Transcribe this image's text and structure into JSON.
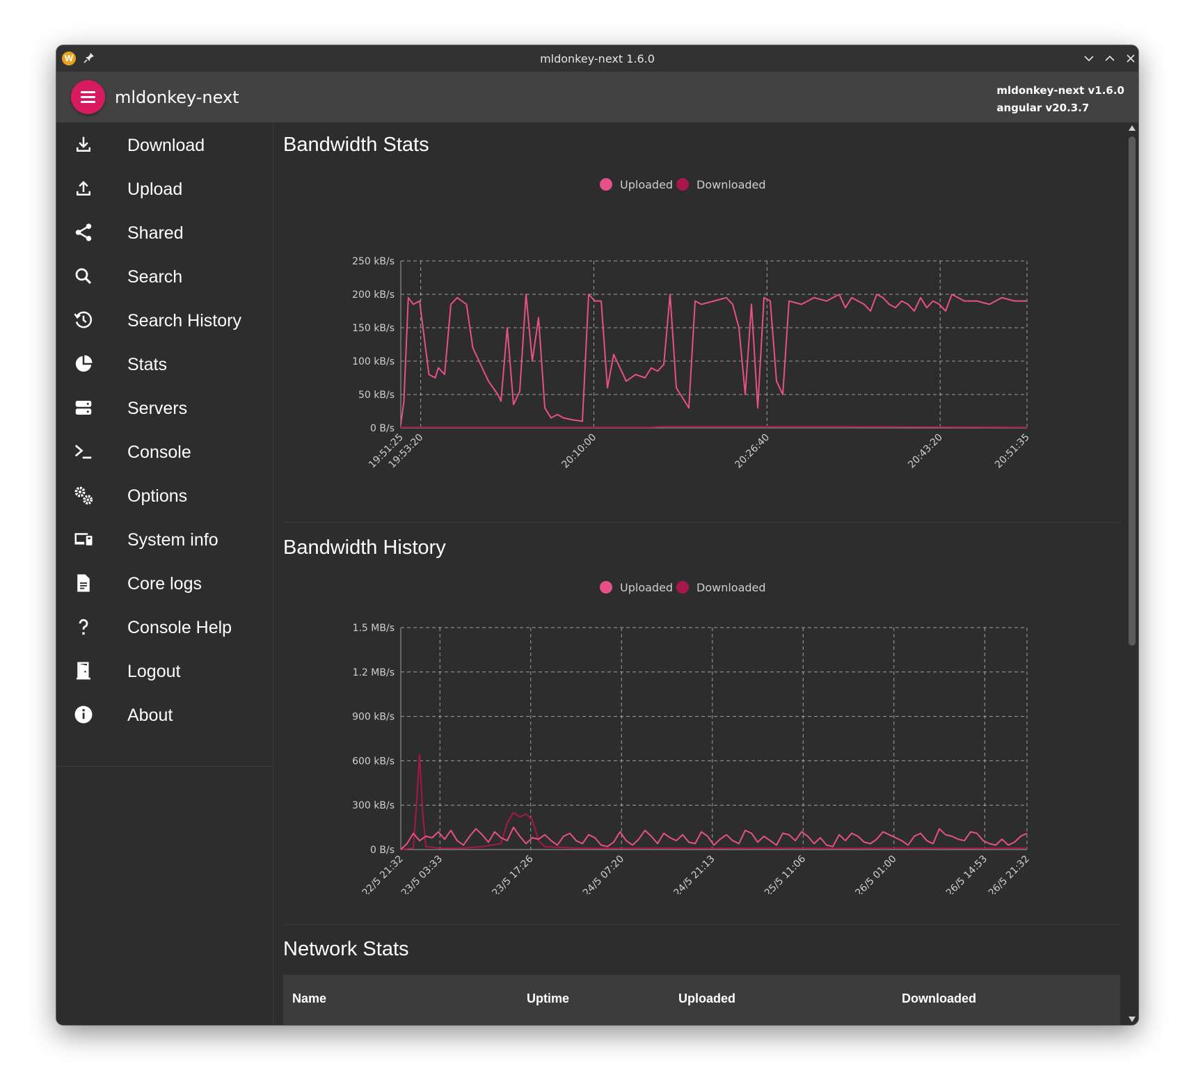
{
  "window": {
    "title": "mldonkey-next 1.6.0"
  },
  "toolbar": {
    "app_title": "mldonkey-next",
    "version_line1": "mldonkey-next v1.6.0",
    "version_line2": "angular v20.3.7"
  },
  "sidebar": {
    "items": [
      {
        "label": "Download",
        "icon": "download-icon"
      },
      {
        "label": "Upload",
        "icon": "upload-icon"
      },
      {
        "label": "Shared",
        "icon": "share-icon"
      },
      {
        "label": "Search",
        "icon": "search-icon"
      },
      {
        "label": "Search History",
        "icon": "history-icon"
      },
      {
        "label": "Stats",
        "icon": "pie-chart-icon"
      },
      {
        "label": "Servers",
        "icon": "servers-icon"
      },
      {
        "label": "Console",
        "icon": "terminal-icon"
      },
      {
        "label": "Options",
        "icon": "gears-icon"
      },
      {
        "label": "System info",
        "icon": "devices-icon"
      },
      {
        "label": "Core logs",
        "icon": "document-icon"
      },
      {
        "label": "Console Help",
        "icon": "question-icon"
      },
      {
        "label": "Logout",
        "icon": "door-icon"
      },
      {
        "label": "About",
        "icon": "info-icon"
      }
    ]
  },
  "colors": {
    "uploaded": "#e8508a",
    "downloaded": "#a8174c",
    "accent": "#d81b60"
  },
  "bandwidth_stats": {
    "title": "Bandwidth Stats",
    "legend": [
      "Uploaded",
      "Downloaded"
    ]
  },
  "bandwidth_history": {
    "title": "Bandwidth History",
    "legend": [
      "Uploaded",
      "Downloaded"
    ]
  },
  "network_stats": {
    "title": "Network Stats",
    "columns": [
      "Name",
      "Uptime",
      "Uploaded",
      "Downloaded"
    ]
  },
  "chart_data": [
    {
      "type": "line",
      "title": "Bandwidth Stats",
      "x_ticks": [
        "19:51:25",
        "19:53:20",
        "20:10:00",
        "20:26:40",
        "20:43:20",
        "20:51:35"
      ],
      "y_ticks": [
        "0 B/s",
        "50 kB/s",
        "100 kB/s",
        "150 kB/s",
        "200 kB/s",
        "250 kB/s"
      ],
      "ylim": [
        0,
        250
      ],
      "y_unit": "kB/s",
      "grid": true,
      "legend_position": "top-center",
      "series": [
        {
          "name": "Uploaded",
          "x_norm": [
            0,
            0.005,
            0.012,
            0.02,
            0.03,
            0.045,
            0.055,
            0.06,
            0.07,
            0.08,
            0.09,
            0.105,
            0.115,
            0.125,
            0.14,
            0.155,
            0.16,
            0.17,
            0.18,
            0.19,
            0.2,
            0.21,
            0.22,
            0.23,
            0.24,
            0.25,
            0.26,
            0.275,
            0.29,
            0.3,
            0.31,
            0.32,
            0.33,
            0.34,
            0.36,
            0.375,
            0.39,
            0.4,
            0.41,
            0.42,
            0.43,
            0.44,
            0.46,
            0.47,
            0.48,
            0.5,
            0.52,
            0.53,
            0.54,
            0.55,
            0.56,
            0.57,
            0.58,
            0.59,
            0.6,
            0.61,
            0.62,
            0.64,
            0.66,
            0.68,
            0.7,
            0.71,
            0.72,
            0.73,
            0.74,
            0.75,
            0.76,
            0.77,
            0.78,
            0.79,
            0.8,
            0.81,
            0.82,
            0.83,
            0.84,
            0.85,
            0.86,
            0.87,
            0.88,
            0.9,
            0.92,
            0.94,
            0.96,
            0.98,
            1.0
          ],
          "values": [
            5,
            40,
            195,
            185,
            190,
            80,
            75,
            90,
            80,
            185,
            195,
            185,
            120,
            100,
            70,
            50,
            40,
            150,
            35,
            55,
            200,
            100,
            165,
            30,
            15,
            20,
            15,
            12,
            10,
            200,
            190,
            190,
            60,
            110,
            70,
            80,
            75,
            90,
            85,
            95,
            200,
            60,
            30,
            190,
            185,
            190,
            195,
            185,
            150,
            50,
            185,
            30,
            195,
            190,
            70,
            50,
            190,
            185,
            195,
            190,
            200,
            180,
            195,
            190,
            185,
            175,
            200,
            195,
            185,
            180,
            190,
            185,
            175,
            195,
            180,
            190,
            185,
            175,
            200,
            190,
            190,
            185,
            195,
            190,
            190
          ]
        },
        {
          "name": "Downloaded",
          "x_norm": [
            0,
            0.4,
            0.42,
            0.7,
            1.0
          ],
          "values": [
            1,
            1,
            2,
            2,
            1
          ]
        }
      ]
    },
    {
      "type": "line",
      "title": "Bandwidth History",
      "x_ticks": [
        "22/5 21:32",
        "23/5 03:33",
        "23/5 17:26",
        "24/5 07:20",
        "24/5 21:13",
        "25/5 11:06",
        "26/5 01:00",
        "26/5 14:53",
        "26/5 21:32"
      ],
      "y_ticks": [
        "0 B/s",
        "300 kB/s",
        "600 kB/s",
        "900 kB/s",
        "1.2 MB/s",
        "1.5 MB/s"
      ],
      "ylim": [
        0,
        1500
      ],
      "y_unit": "kB/s",
      "grid": true,
      "legend_position": "top-center",
      "series": [
        {
          "name": "Uploaded",
          "x_norm": [
            0,
            0.01,
            0.02,
            0.03,
            0.04,
            0.05,
            0.06,
            0.07,
            0.08,
            0.09,
            0.1,
            0.11,
            0.12,
            0.13,
            0.14,
            0.15,
            0.16,
            0.17,
            0.18,
            0.19,
            0.2,
            0.21,
            0.22,
            0.23,
            0.24,
            0.25,
            0.26,
            0.27,
            0.28,
            0.29,
            0.3,
            0.31,
            0.32,
            0.33,
            0.34,
            0.35,
            0.36,
            0.37,
            0.38,
            0.39,
            0.4,
            0.41,
            0.42,
            0.43,
            0.44,
            0.45,
            0.46,
            0.47,
            0.48,
            0.49,
            0.5,
            0.51,
            0.52,
            0.53,
            0.54,
            0.55,
            0.56,
            0.57,
            0.58,
            0.59,
            0.6,
            0.61,
            0.62,
            0.63,
            0.64,
            0.65,
            0.66,
            0.67,
            0.68,
            0.69,
            0.7,
            0.71,
            0.72,
            0.73,
            0.74,
            0.75,
            0.76,
            0.77,
            0.78,
            0.79,
            0.8,
            0.81,
            0.82,
            0.83,
            0.84,
            0.85,
            0.86,
            0.87,
            0.88,
            0.89,
            0.9,
            0.91,
            0.92,
            0.93,
            0.94,
            0.95,
            0.96,
            0.97,
            0.98,
            0.99,
            1.0
          ],
          "values": [
            0,
            40,
            110,
            60,
            90,
            80,
            120,
            70,
            130,
            60,
            30,
            90,
            140,
            100,
            50,
            120,
            80,
            60,
            150,
            90,
            40,
            80,
            70,
            100,
            60,
            30,
            90,
            110,
            60,
            40,
            100,
            80,
            30,
            20,
            50,
            120,
            60,
            30,
            70,
            130,
            90,
            40,
            110,
            80,
            60,
            100,
            50,
            40,
            120,
            90,
            30,
            70,
            100,
            60,
            40,
            130,
            110,
            50,
            90,
            60,
            30,
            110,
            100,
            60,
            120,
            90,
            40,
            80,
            30,
            20,
            100,
            60,
            110,
            90,
            50,
            40,
            70,
            120,
            100,
            80,
            60,
            30,
            90,
            110,
            60,
            40,
            140,
            100,
            90,
            70,
            60,
            120,
            110,
            60,
            40,
            30,
            70,
            30,
            50,
            90,
            110
          ]
        },
        {
          "name": "Downloaded",
          "x_norm": [
            0,
            0.02,
            0.025,
            0.03,
            0.035,
            0.04,
            0.05,
            0.06,
            0.08,
            0.1,
            0.13,
            0.16,
            0.17,
            0.18,
            0.19,
            0.2,
            0.21,
            0.22,
            0.23,
            0.25,
            0.28,
            0.32,
            0.4,
            0.5,
            0.6,
            0.7,
            0.8,
            0.9,
            1.0
          ],
          "values": [
            0,
            10,
            300,
            640,
            250,
            20,
            15,
            10,
            8,
            10,
            20,
            40,
            180,
            250,
            220,
            240,
            200,
            60,
            20,
            15,
            10,
            8,
            10,
            8,
            10,
            8,
            10,
            8,
            10
          ]
        }
      ]
    }
  ]
}
